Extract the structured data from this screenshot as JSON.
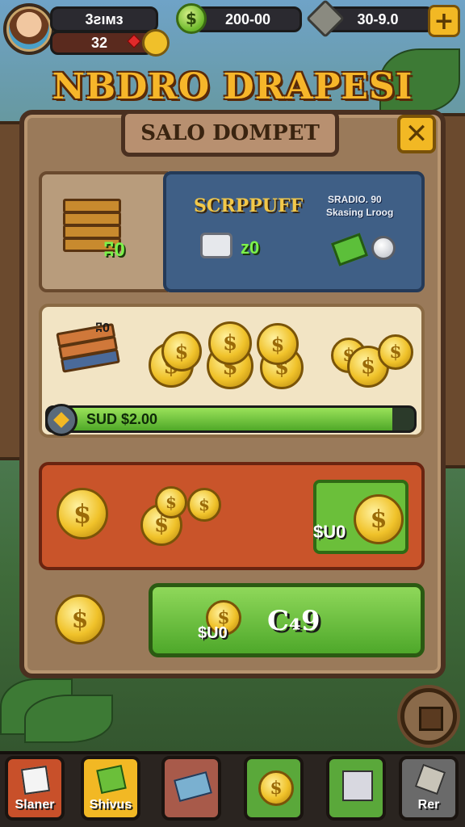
{
  "hud": {
    "player_name": "3ƨıмз",
    "level": "32",
    "coins": "200-00",
    "stones": "30-9.0",
    "plus_label": "+"
  },
  "title": "NBDRO DRAPESI",
  "panel": {
    "title": "SALO DOMPET",
    "close_label": "✕"
  },
  "row1": {
    "left_value": "ʭ0",
    "right_title": "SCRPPUFF",
    "right_stat_line1": "SRADIO. 90",
    "right_stat_line2": "Skasing Lroog",
    "right_value": "z0"
  },
  "row2": {
    "book_tag": "ʭ0",
    "progress_label": "SUD $2.00",
    "progress_fraction": 0.94
  },
  "row3": {
    "box_value": "$U0"
  },
  "row4": {
    "buy_price": "$U0",
    "buy_label": "C₄9"
  },
  "nav": {
    "items": [
      {
        "label": "Slaner",
        "color": "#c8502a"
      },
      {
        "label": "Shivus",
        "color": "#f2b824"
      },
      {
        "label": "",
        "color": "#a85a4a"
      },
      {
        "label": "",
        "color": "#5aa83a"
      },
      {
        "label": "",
        "color": "#5aa83a"
      },
      {
        "label": "Rer",
        "color": "#6a6a6a"
      }
    ]
  }
}
